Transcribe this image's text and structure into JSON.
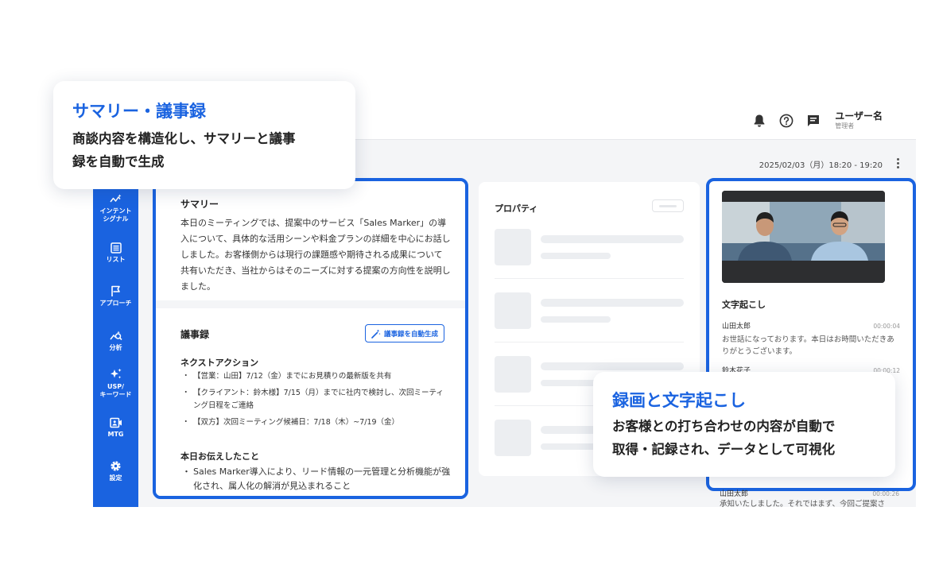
{
  "header": {
    "user_name": "ユーザー名",
    "user_role": "管理者"
  },
  "sidebar": {
    "items": [
      {
        "label": "インテント\nシグナル",
        "icon": "intent-signal-icon"
      },
      {
        "label": "リスト",
        "icon": "list-icon"
      },
      {
        "label": "アプローチ",
        "icon": "flag-icon"
      },
      {
        "label": "分析",
        "icon": "analysis-icon"
      },
      {
        "label": "USP/\nキーワード",
        "icon": "sparkle-icon"
      },
      {
        "label": "MTG",
        "icon": "meeting-video-icon"
      },
      {
        "label": "設定",
        "icon": "gear-icon"
      }
    ]
  },
  "meeting": {
    "datetime": "2025/02/03（月）18:20 - 19:20"
  },
  "summary": {
    "title": "サマリー",
    "text": "本日のミーティングでは、提案中のサービス「Sales Marker」の導入について、具体的な活用シーンや料金プランの詳細を中心にお話ししました。お客様側からは現行の課題感や期待される成果について共有いただき、当社からはそのニーズに対する提案の方向性を説明しました。"
  },
  "minutes": {
    "title": "議事録",
    "generate_button": "議事録を自動生成",
    "next_action_title": "ネクストアクション",
    "next_actions": [
      "【営業：山田】7/12（金）までにお見積りの最新版を共有",
      "【クライアント：鈴木様】7/15（月）までに社内で検討し、次回ミーティング日程をご連絡",
      "【双方】次回ミーティング候補日：7/18（木）~7/19（金）"
    ],
    "told_title": "本日お伝えしたこと",
    "told_items": [
      "Sales Marker導入により、リード情報の一元管理と分析機能が強化され、属人化の解消が見込まれること"
    ]
  },
  "properties": {
    "title": "プロパティ"
  },
  "transcript": {
    "title": "文字起こし",
    "entries": [
      {
        "speaker": "山田太郎",
        "time": "00:00:04",
        "text": "お世話になっております。本日はお時間いただきありがとうございます。"
      },
      {
        "speaker": "鈴木花子",
        "time": "00:00:12",
        "text": ""
      }
    ],
    "last_entry": {
      "speaker": "山田太郎",
      "time": "00:00:26",
      "text": "承知いたしました。それではまず、今回ご提案さ"
    }
  },
  "callouts": [
    {
      "title": "サマリー・議事録",
      "body": "商談内容を構造化し、サマリーと議事\n録を自動で生成"
    },
    {
      "title": "録画と文字起こし",
      "body": "お客様との打ち合わせの内容が自動で\n取得・記録され、データとして可視化"
    }
  ],
  "colors": {
    "accent": "#1a63e0",
    "background": "#f4f5f7"
  }
}
